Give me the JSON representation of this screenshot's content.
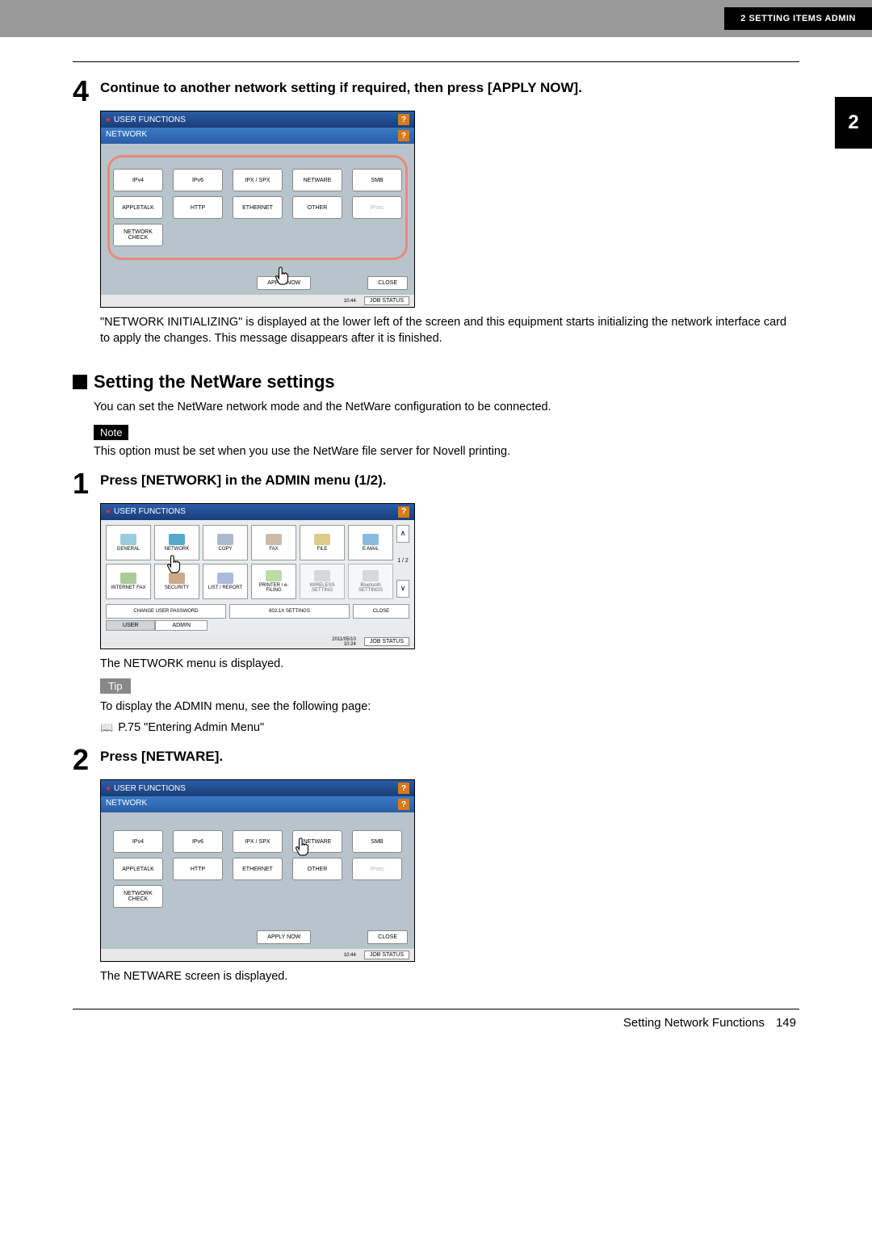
{
  "header": {
    "badge": "2 SETTING ITEMS ADMIN"
  },
  "side_badge": "2",
  "step4": {
    "num": "4",
    "title": "Continue to another network setting if required, then press [APPLY NOW].",
    "after_text": "\"NETWORK INITIALIZING\" is displayed at the lower left of the screen and this equipment starts initializing the network interface card to apply the changes. This message disappears after it is finished."
  },
  "screenshot1": {
    "title": "USER FUNCTIONS",
    "subbar": "NETWORK",
    "buttons_r1": [
      "IPv4",
      "IPv6",
      "IPX / SPX",
      "NETWARE",
      "SMB"
    ],
    "buttons_r2": [
      "APPLETALK",
      "HTTP",
      "ETHERNET",
      "OTHER",
      "IPsec"
    ],
    "buttons_r3": [
      "NETWORK CHECK"
    ],
    "apply": "APPLY NOW",
    "close": "CLOSE",
    "job": "JOB STATUS",
    "time": "10:44"
  },
  "section": {
    "title": "Setting the NetWare settings",
    "intro": "You can set the NetWare network mode and the NetWare configuration to be connected.",
    "note_label": "Note",
    "note_text": "This option must be set when you use the NetWare file server for Novell printing."
  },
  "step1": {
    "num": "1",
    "title": "Press [NETWORK] in the ADMIN menu (1/2).",
    "after_text": "The NETWORK menu is displayed.",
    "tip_label": "Tip",
    "tip_text": "To display the ADMIN menu, see the following page:",
    "ref": "P.75 \"Entering Admin Menu\""
  },
  "screenshot2": {
    "title": "USER FUNCTIONS",
    "row1": [
      "GENERAL",
      "NETWORK",
      "COPY",
      "FAX",
      "FILE",
      "E-MAIL"
    ],
    "row2": [
      "INTERNET FAX",
      "SECURITY",
      "LIST / REPORT",
      "PRINTER / e-FILING",
      "WIRELESS SETTING",
      "Bluetooth SETTINGS"
    ],
    "wide1": "CHANGE USER PASSWORD",
    "wide2": "802.1X SETTINGS",
    "close": "CLOSE",
    "tab_user": "USER",
    "tab_admin": "ADMIN",
    "job": "JOB STATUS",
    "date": "2011/05/10",
    "time": "10:24",
    "pager_mid": "1 / 2"
  },
  "step2": {
    "num": "2",
    "title": "Press [NETWARE].",
    "after_text": "The NETWARE screen is displayed."
  },
  "screenshot3": {
    "title": "USER FUNCTIONS",
    "subbar": "NETWORK",
    "buttons_r1": [
      "IPv4",
      "IPv6",
      "IPX / SPX",
      "NETWARE",
      "SMB"
    ],
    "buttons_r2": [
      "APPLETALK",
      "HTTP",
      "ETHERNET",
      "OTHER",
      "IPsec"
    ],
    "buttons_r3": [
      "NETWORK CHECK"
    ],
    "apply": "APPLY NOW",
    "close": "CLOSE",
    "job": "JOB STATUS",
    "time": "10:44"
  },
  "footer": {
    "section": "Setting Network Functions",
    "page": "149"
  }
}
